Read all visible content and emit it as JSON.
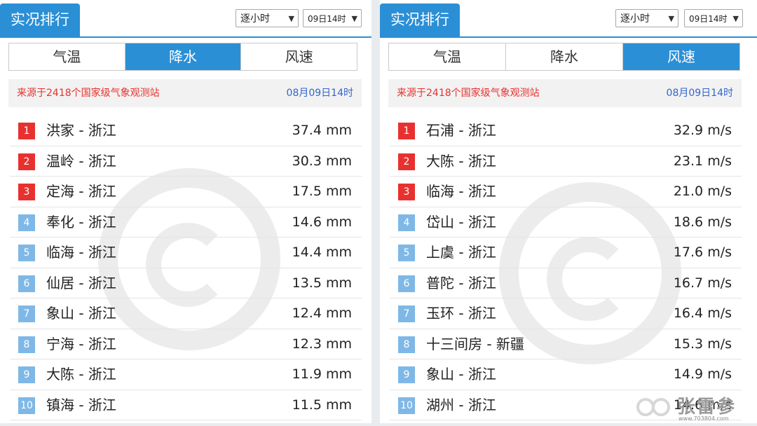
{
  "left": {
    "title": "实况排行",
    "interval_select": "逐小时",
    "time_select": "09日14时",
    "tabs": [
      {
        "label": "气温",
        "active": false
      },
      {
        "label": "降水",
        "active": true
      },
      {
        "label": "风速",
        "active": false
      }
    ],
    "source": "来源于2418个国家级气象观测站",
    "datetime": "08月09日14时",
    "rows": [
      {
        "rank": "1",
        "name": "洪家 - 浙江",
        "value": "37.4 mm"
      },
      {
        "rank": "2",
        "name": "温岭 - 浙江",
        "value": "30.3 mm"
      },
      {
        "rank": "3",
        "name": "定海 - 浙江",
        "value": "17.5 mm"
      },
      {
        "rank": "4",
        "name": "奉化 - 浙江",
        "value": "14.6 mm"
      },
      {
        "rank": "5",
        "name": "临海 - 浙江",
        "value": "14.4 mm"
      },
      {
        "rank": "6",
        "name": "仙居 - 浙江",
        "value": "13.5 mm"
      },
      {
        "rank": "7",
        "name": "象山 - 浙江",
        "value": "12.4 mm"
      },
      {
        "rank": "8",
        "name": "宁海 - 浙江",
        "value": "12.3 mm"
      },
      {
        "rank": "9",
        "name": "大陈 - 浙江",
        "value": "11.9 mm"
      },
      {
        "rank": "10",
        "name": "镇海 - 浙江",
        "value": "11.5 mm"
      }
    ]
  },
  "right": {
    "title": "实况排行",
    "interval_select": "逐小时",
    "time_select": "09日14时",
    "tabs": [
      {
        "label": "气温",
        "active": false
      },
      {
        "label": "降水",
        "active": false
      },
      {
        "label": "风速",
        "active": true
      }
    ],
    "source": "来源于2418个国家级气象观测站",
    "datetime": "08月09日14时",
    "rows": [
      {
        "rank": "1",
        "name": "石浦 - 浙江",
        "value": "32.9 m/s"
      },
      {
        "rank": "2",
        "name": "大陈 - 浙江",
        "value": "23.1 m/s"
      },
      {
        "rank": "3",
        "name": "临海 - 浙江",
        "value": "21.0 m/s"
      },
      {
        "rank": "4",
        "name": "岱山 - 浙江",
        "value": "18.6 m/s"
      },
      {
        "rank": "5",
        "name": "上虞 - 浙江",
        "value": "17.6 m/s"
      },
      {
        "rank": "6",
        "name": "普陀 - 浙江",
        "value": "16.7 m/s"
      },
      {
        "rank": "7",
        "name": "玉环 - 浙江",
        "value": "16.4 m/s"
      },
      {
        "rank": "8",
        "name": "十三间房 - 新疆",
        "value": "15.3 m/s"
      },
      {
        "rank": "9",
        "name": "象山 - 浙江",
        "value": "14.9 m/s"
      },
      {
        "rank": "10",
        "name": "湖州 - 浙江",
        "value": "14.6 m/s"
      }
    ]
  },
  "colors": {
    "accent": "#2b8fd6",
    "top_rank": "#e8312f",
    "rank": "#7fb8e6",
    "source_text": "#e8312f",
    "time_text": "#3366cc"
  },
  "watermark": {
    "text": "张雷参",
    "url": "www.703804.com"
  }
}
